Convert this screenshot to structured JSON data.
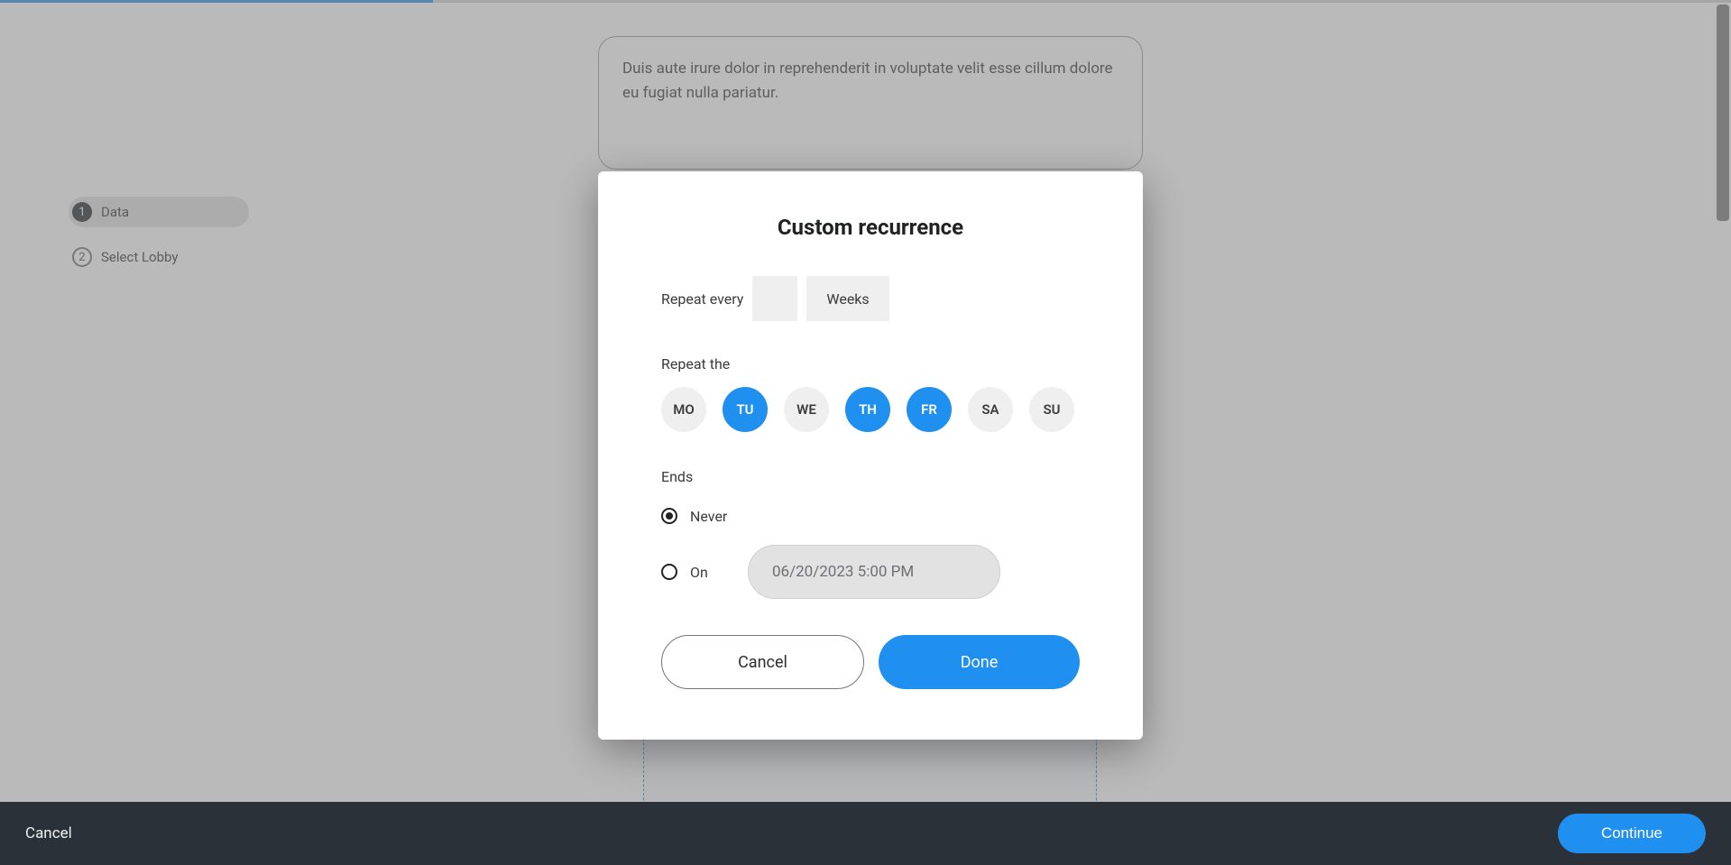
{
  "stepper": {
    "items": [
      {
        "num": "1",
        "label": "Data",
        "active": true
      },
      {
        "num": "2",
        "label": "Select Lobby",
        "active": false
      }
    ]
  },
  "description_text": "Duis aute irure dolor in reprehenderit in voluptate velit esse cillum dolore eu fugiat nulla pariatur.",
  "bottombar": {
    "cancel": "Cancel",
    "continue": "Continue"
  },
  "modal": {
    "title": "Custom recurrence",
    "repeat_every_label": "Repeat every",
    "interval_value": "",
    "interval_unit": "Weeks",
    "repeat_the_label": "Repeat the",
    "days": [
      {
        "code": "MO",
        "selected": false
      },
      {
        "code": "TU",
        "selected": true
      },
      {
        "code": "WE",
        "selected": false
      },
      {
        "code": "TH",
        "selected": true
      },
      {
        "code": "FR",
        "selected": true
      },
      {
        "code": "SA",
        "selected": false
      },
      {
        "code": "SU",
        "selected": false
      }
    ],
    "ends_label": "Ends",
    "ends_options": {
      "never": {
        "label": "Never",
        "selected": true
      },
      "on": {
        "label": "On",
        "selected": false,
        "value": "06/20/2023 5:00 PM"
      }
    },
    "cancel": "Cancel",
    "done": "Done"
  }
}
